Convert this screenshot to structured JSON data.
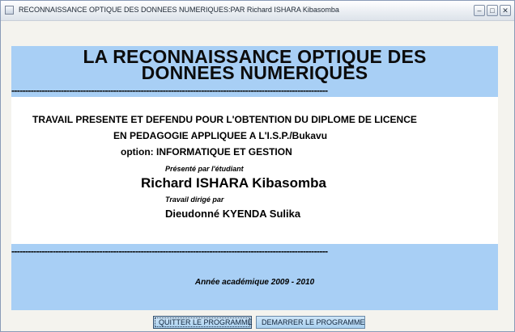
{
  "window": {
    "title": "RECONNAISSANCE OPTIQUE DES DONNEES NUMERIQUES:PAR Richard ISHARA Kibasomba",
    "minimize_glyph": "–",
    "maximize_glyph": "□",
    "close_glyph": "✕"
  },
  "header": {
    "title_line1": "LA RECONNAISSANCE OPTIQUE DES",
    "title_line2": "DONNEES NUMERIQUES",
    "separator": "-------------------------------------------------------------------------------------------------------------------"
  },
  "body": {
    "travail": "TRAVAIL PRESENTE ET DEFENDU POUR L'OBTENTION DU DIPLOME DE LICENCE",
    "pedagogie": "EN PEDAGOGIE APPLIQUEE A L'I.S.P./Bukavu",
    "option": "option:  INFORMATIQUE ET GESTION",
    "presente_par": "Présenté par l'étudiant",
    "student": "Richard ISHARA Kibasomba",
    "dirige_par": "Travail dirigé par",
    "director": "Dieudonné KYENDA Sulika"
  },
  "footer": {
    "separator": "-------------------------------------------------------------------------------------------------------------------",
    "academic_year": "Année académique 2009 - 2010"
  },
  "buttons": {
    "quit_label": "QUITTER LE PROGRAMME",
    "start_label": "DEMARRER LE PROGRAMME"
  },
  "colors": {
    "band": "#a8cff5",
    "panel": "#ffffff",
    "window_bg": "#f4f3ee",
    "button": "#a9d0ef"
  }
}
